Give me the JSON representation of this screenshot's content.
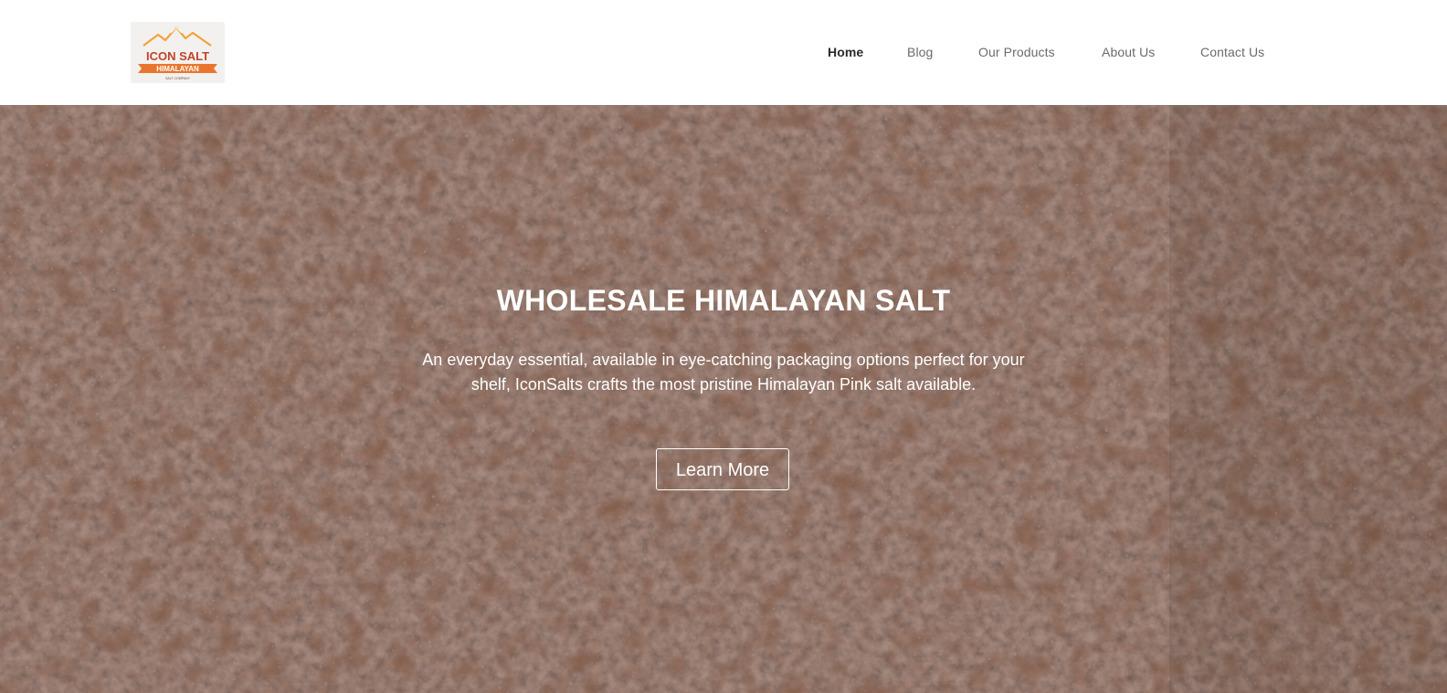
{
  "brand": {
    "logo_line1": "ICON SALT",
    "logo_line2": "HIMALAYAN",
    "logo_tagline": "SALT COMPANY"
  },
  "nav": {
    "items": [
      {
        "label": "Home",
        "active": true
      },
      {
        "label": "Blog",
        "active": false
      },
      {
        "label": "Our Products",
        "active": false
      },
      {
        "label": "About Us",
        "active": false
      },
      {
        "label": "Contact Us",
        "active": false
      }
    ]
  },
  "hero": {
    "title": "WHOLESALE HIMALAYAN SALT",
    "description": "An everyday essential, available in eye-catching packaging options perfect for your shelf, IconSalts crafts the most pristine Himalayan Pink salt available.",
    "button_label": "Learn More",
    "background": "himalayan-salt-crystals-photo"
  },
  "colors": {
    "accent": "#e8762f",
    "logo_mountain": "#f2a23a",
    "hero_text": "#ffffff",
    "nav_active": "#2b2b2b",
    "nav_inactive": "#6b6b6b"
  }
}
